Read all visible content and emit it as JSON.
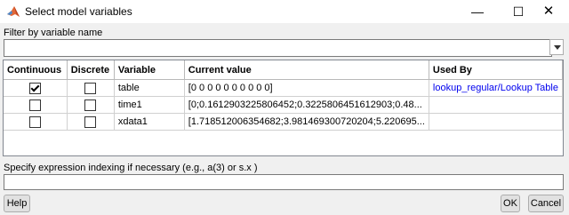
{
  "window": {
    "title": "Select model variables",
    "minimize_glyph": "—",
    "maximize_glyph": "☐",
    "close_glyph": "✕"
  },
  "filter": {
    "label": "Filter by variable name",
    "value": ""
  },
  "table": {
    "columns": [
      "Continuous",
      "Discrete",
      "Variable",
      "Current value",
      "Used By"
    ],
    "rows": [
      {
        "continuous": true,
        "discrete": false,
        "variable": "table",
        "current_value": "[0 0 0 0 0 0 0 0 0 0]",
        "used_by": "lookup_regular/Lookup Table"
      },
      {
        "continuous": false,
        "discrete": false,
        "variable": "time1",
        "current_value": "[0;0.1612903225806452;0.3225806451612903;0.48...",
        "used_by": ""
      },
      {
        "continuous": false,
        "discrete": false,
        "variable": "xdata1",
        "current_value": "[1.718512006354682;3.981469300720204;5.220695...",
        "used_by": ""
      }
    ]
  },
  "expression": {
    "label": "Specify expression indexing if necessary (e.g., a(3) or s.x )",
    "value": ""
  },
  "buttons": {
    "help": "Help",
    "ok": "OK",
    "cancel": "Cancel"
  },
  "colors": {
    "link": "#0000ee",
    "background": "#f0f0f0"
  }
}
